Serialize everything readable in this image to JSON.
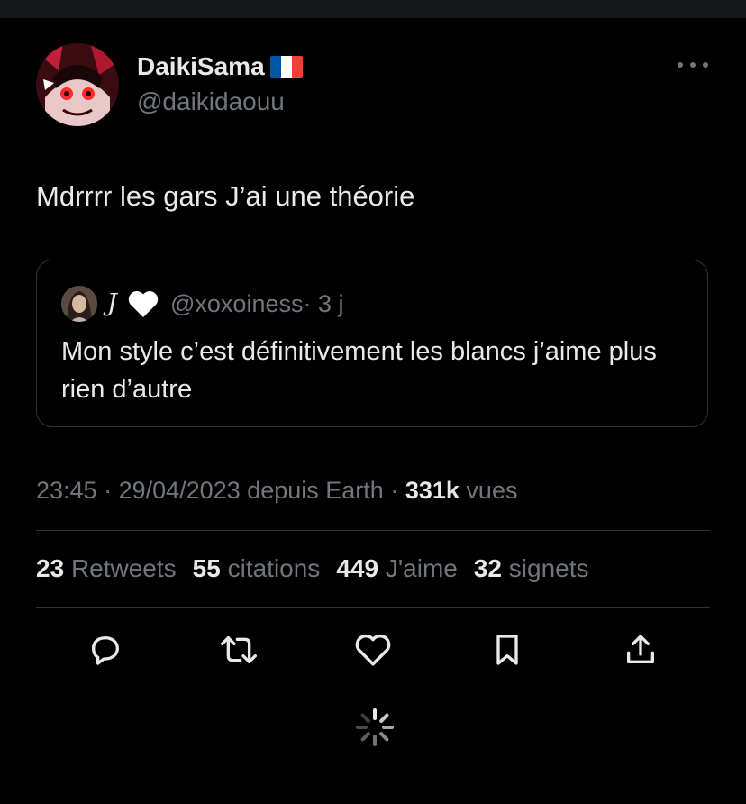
{
  "tweet": {
    "author": {
      "display_name": "DaikiSama",
      "handle": "@daikidaouu"
    },
    "text": "Mdrrrr les gars J’ai une théorie",
    "quoted": {
      "name": "J",
      "handle": "@xoxoiness",
      "age": "· 3 j",
      "text": "Mon style c’est définitivement les blancs j’aime plus rien d’autre"
    },
    "meta": {
      "time": "23:45",
      "date": "· 29/04/2023 depuis Earth ·",
      "views_count": "331k",
      "views_label": "vues"
    },
    "stats": [
      {
        "num": "23",
        "label": "Retweets"
      },
      {
        "num": "55",
        "label": "citations"
      },
      {
        "num": "449",
        "label": "J'aime"
      },
      {
        "num": "32",
        "label": "signets"
      }
    ]
  },
  "icons": {
    "more": "more-icon",
    "reply": "reply-icon",
    "retweet": "retweet-icon",
    "like": "heart-icon",
    "bookmark": "bookmark-icon",
    "share": "share-icon",
    "loading": "loading-spinner-icon",
    "flag": "france-flag-icon"
  },
  "colors": {
    "background": "#000000",
    "text": "#e7e9ea",
    "secondary": "#71767b",
    "border": "#2f3336",
    "flag_blue": "#0055a4",
    "flag_white": "#ffffff",
    "flag_red": "#ef4135"
  }
}
